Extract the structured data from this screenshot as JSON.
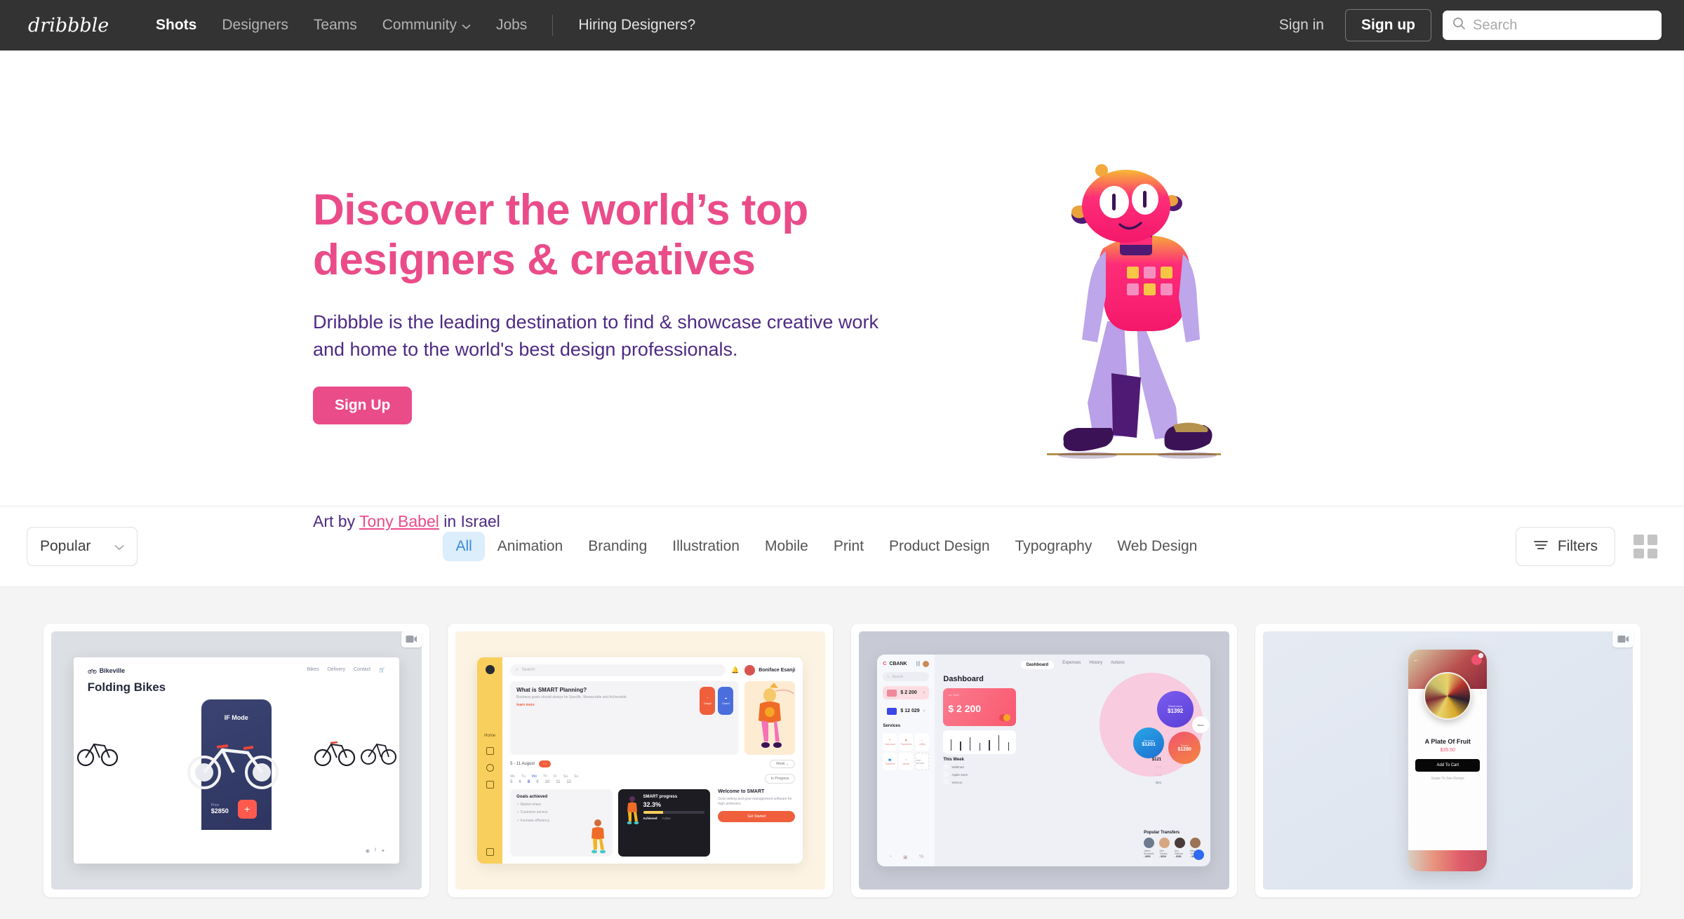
{
  "header": {
    "logo_icon": "dribbble-wordmark-logo",
    "nav": [
      {
        "label": "Shots",
        "active": true,
        "has_chevron": false
      },
      {
        "label": "Designers",
        "active": false,
        "has_chevron": false
      },
      {
        "label": "Teams",
        "active": false,
        "has_chevron": false
      },
      {
        "label": "Community",
        "active": false,
        "has_chevron": true
      },
      {
        "label": "Jobs",
        "active": false,
        "has_chevron": false
      }
    ],
    "hiring_link": "Hiring Designers?",
    "sign_in": "Sign in",
    "sign_up": "Sign up",
    "search": {
      "placeholder": "Search",
      "value": "",
      "icon": "search-icon"
    },
    "bg_color": "#333333"
  },
  "hero": {
    "title": "Discover the world’s top designers & creatives",
    "subtitle": "Dribbble is the leading destination to find & showcase creative work and home to the world's best design professionals.",
    "cta_label": "Sign Up",
    "credit_prefix": "Art by ",
    "credit_author": "Tony Babel",
    "credit_suffix": " in Israel",
    "title_color": "#ea4c89",
    "subtitle_color": "#4e2a84",
    "illustration": "robot-mascot-illustration"
  },
  "filterbar": {
    "sort": {
      "label": "Popular",
      "icon": "chevron-down-icon"
    },
    "categories": [
      {
        "label": "All",
        "active": true
      },
      {
        "label": "Animation",
        "active": false
      },
      {
        "label": "Branding",
        "active": false
      },
      {
        "label": "Illustration",
        "active": false
      },
      {
        "label": "Mobile",
        "active": false
      },
      {
        "label": "Print",
        "active": false
      },
      {
        "label": "Product Design",
        "active": false
      },
      {
        "label": "Typography",
        "active": false
      },
      {
        "label": "Web Design",
        "active": false
      }
    ],
    "filters_label": "Filters",
    "filters_icon": "filter-lines-icon",
    "grid_toggle_icon": "grid-view-icon",
    "active_color": "#3b8bd6",
    "active_bg": "#dcedfb"
  },
  "shots": [
    {
      "name": "bikeville-folding-bikes",
      "has_video_badge": true,
      "brand": "Bikeville",
      "nav": [
        "Bikes",
        "Delivery",
        "Contact"
      ],
      "title": "Folding Bikes",
      "product": "IF Mode",
      "price_label": "Price",
      "price": "$2850",
      "action": "+"
    },
    {
      "name": "smart-planning-dashboard",
      "has_video_badge": false,
      "search_placeholder": "Search",
      "user": "Boniface Esanji",
      "promo_title": "What is SMART Planning?",
      "promo_body": "Business goals should always be Specific, Measurable and Achievable.",
      "promo_link": "learn more",
      "pills": [
        "Graph",
        "Cloud"
      ],
      "sidebar_label": "Home",
      "week_range": "5 - 11 August",
      "view_label": "Week",
      "status_label": "In Progress",
      "day_names": [
        "Mo",
        "Tu",
        "We",
        "Th",
        "Fr",
        "Sa",
        "Su"
      ],
      "day_numbers": [
        "5",
        "6",
        "8",
        "9",
        "10",
        "11",
        "12"
      ],
      "goals_title": "Goals achieved",
      "goals": [
        "Market share",
        "Customer service",
        "Increase efficiency"
      ],
      "progress_title": "SMART progress",
      "progress_value": "32.3%",
      "progress_percent": 32.3,
      "progress_tabs": [
        "Achieved",
        "Active"
      ],
      "welcome_title": "Welcome to SMART",
      "welcome_body": "Goal setting and goal management software for high achievers.",
      "welcome_cta": "Get Started"
    },
    {
      "name": "cbank-finance-dashboard",
      "has_video_badge": false,
      "brand": "CBANK",
      "search_placeholder": "Search",
      "tabs": [
        "Dashboard",
        "Expenses",
        "History",
        "Actions"
      ],
      "heading": "Dashboard",
      "accounts": [
        {
          "label": "",
          "amount": "$ 2 200"
        },
        {
          "label": "",
          "amount": "$ 12 029"
        }
      ],
      "card_amount": "$ 2 200",
      "services_title": "Services",
      "services": [
        "Insurance",
        "Payments",
        "Utility",
        "Transfers",
        "Media",
        "Add service"
      ],
      "bubbles": [
        {
          "label": "Electronics",
          "amount": "$1392"
        },
        {
          "label": "Services",
          "amount": "$1201"
        },
        {
          "label": "Travel",
          "amount": "$1280"
        },
        {
          "label": "More",
          "amount": ""
        }
      ],
      "week_title": "This Week",
      "week_total": "$121",
      "transactions": [
        {
          "name": "Wallmart",
          "time": "13:08",
          "amount": "-$21"
        },
        {
          "name": "Apple store",
          "time": "13:08",
          "amount": "-$35"
        },
        {
          "name": "Verizon",
          "time": "11:28",
          "amount": "-$41"
        }
      ],
      "transfers_title": "Popular Transfers",
      "transfers": [
        {
          "name": "James Bonhardts",
          "amount": "- $251"
        },
        {
          "name": "John Thomas",
          "amount": "- $234"
        },
        {
          "name": "Ann Williams",
          "amount": "- $151"
        },
        {
          "name": "Mary Smithson",
          "amount": "- $105"
        }
      ]
    },
    {
      "name": "a-plate-of-fruit-app",
      "has_video_badge": true,
      "product_title": "A Plate Of Fruit",
      "price": "$35.50",
      "cta": "Add To Cart",
      "hint": "Swipe To See Recipe",
      "cart_count": "0"
    }
  ]
}
